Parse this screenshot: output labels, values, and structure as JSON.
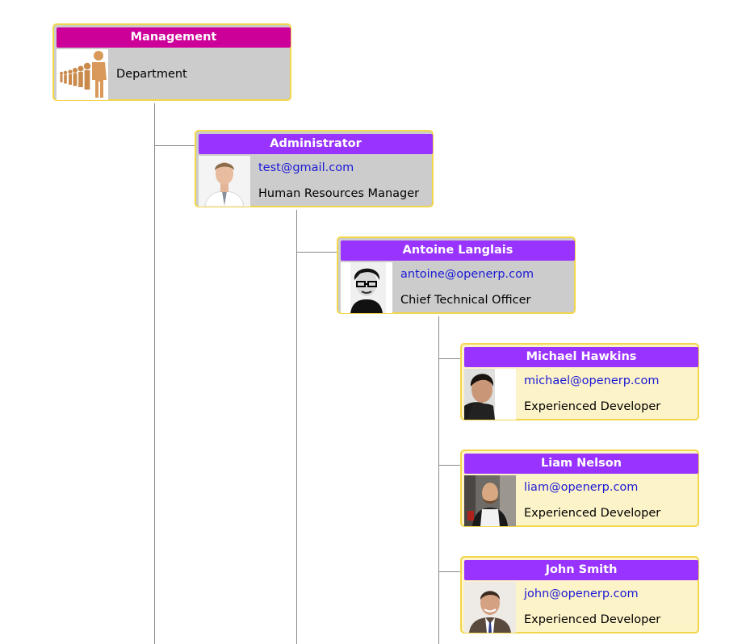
{
  "colors": {
    "department_header": "#cc0099",
    "employee_header": "#9933ff",
    "node_border": "#f2d64b",
    "node_bg_gray": "#cccccc",
    "node_bg_cream": "#fdf3c8",
    "email_text": "#1a1ad6",
    "connector": "#8a8a8a"
  },
  "nodes": [
    {
      "name": "Management",
      "subtitle": "Department",
      "icon": "department-people-icon"
    },
    {
      "name": "Administrator",
      "email": "test@gmail.com",
      "job": "Human Resources Manager",
      "icon": "person-photo"
    },
    {
      "name": "Antoine Langlais",
      "email": "antoine@openerp.com",
      "job": "Chief Technical Officer",
      "icon": "person-photo"
    },
    {
      "name": "Michael Hawkins",
      "email": "michael@openerp.com",
      "job": "Experienced Developer",
      "icon": "person-photo"
    },
    {
      "name": "Liam Nelson",
      "email": "liam@openerp.com",
      "job": "Experienced Developer",
      "icon": "person-photo"
    },
    {
      "name": "John Smith",
      "email": "john@openerp.com",
      "job": "Experienced Developer",
      "icon": "person-photo"
    }
  ]
}
